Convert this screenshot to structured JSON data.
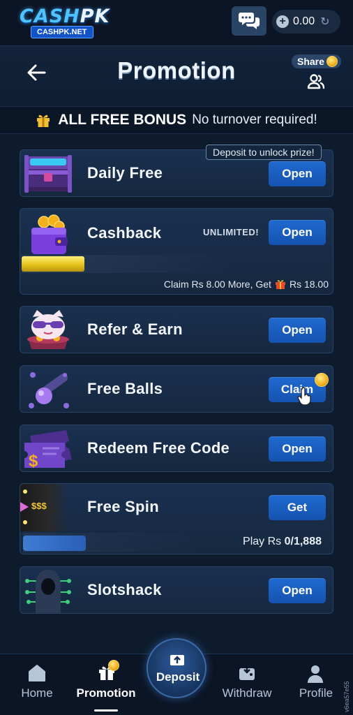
{
  "header": {
    "logo_main": "CASH",
    "logo_main_pk": "PK",
    "logo_sub": "CASHPK.NET",
    "balance": "0.00",
    "colors": {
      "accent": "#1f6ad0",
      "background": "#0d1b2d"
    }
  },
  "titlebar": {
    "title": "Promotion",
    "share_label": "Share"
  },
  "banner": {
    "strong": "ALL FREE BONUS",
    "light": "No turnover required!"
  },
  "cards": {
    "daily_free": {
      "title": "Daily Free",
      "badge": "Deposit to unlock prize!",
      "button": "Open"
    },
    "cashback": {
      "title": "Cashback",
      "tag": "UNLIMITED!",
      "button": "Open",
      "claim_prefix": "Claim Rs 8.00 More, Get",
      "claim_reward": "Rs 18.00"
    },
    "refer": {
      "title": "Refer & Earn",
      "button": "Open"
    },
    "free_balls": {
      "title": "Free Balls",
      "button": "Claim"
    },
    "redeem": {
      "title": "Redeem Free Code",
      "button": "Open"
    },
    "free_spin": {
      "title": "Free Spin",
      "button": "Get",
      "play_prefix": "Play Rs",
      "play_value": "0/1,888",
      "spin_label": "$$$"
    },
    "slotshack": {
      "title": "Slotshack",
      "button": "Open"
    }
  },
  "bottom_nav": {
    "home": "Home",
    "promotion": "Promotion",
    "deposit": "Deposit",
    "withdraw": "Withdraw",
    "profile": "Profile",
    "active": "promotion"
  },
  "side_id": "v6ea57e55"
}
